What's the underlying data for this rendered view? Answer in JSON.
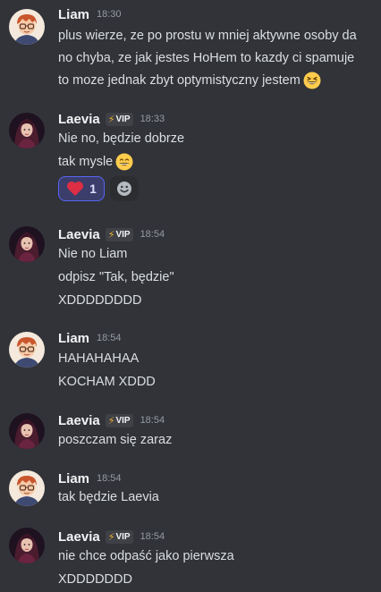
{
  "messages": [
    {
      "author": "Liam",
      "time": "18:30",
      "lines": [
        "plus wierze, ze po prostu w mniej aktywne osoby da",
        "no chyba, ze jak jestes HoHem to kazdy ci spamuje",
        "to moze jednak zbyt optymistyczny jestem"
      ]
    },
    {
      "author": "Laevia",
      "badge": "VIP",
      "time": "18:33",
      "lines": [
        "Nie no, będzie dobrze",
        "tak mysle"
      ],
      "reaction": {
        "emoji": "heart",
        "count": "1"
      }
    },
    {
      "author": "Laevia",
      "badge": "VIP",
      "time": "18:54",
      "lines": [
        "Nie no Liam",
        "odpisz \"Tak, będzie\"",
        "XDDDDDDDD"
      ]
    },
    {
      "author": "Liam",
      "time": "18:54",
      "lines": [
        "HAHAHAHAA",
        "KOCHAM XDDD"
      ]
    },
    {
      "author": "Laevia",
      "badge": "VIP",
      "time": "18:54",
      "lines": [
        "poszczam się zaraz"
      ]
    },
    {
      "author": "Liam",
      "time": "18:54",
      "lines": [
        "tak będzie Laevia"
      ]
    },
    {
      "author": "Laevia",
      "badge": "VIP",
      "time": "18:54",
      "lines": [
        "nie chce odpaść jako pierwsza",
        "XDDDDDDD"
      ]
    }
  ],
  "colors": {
    "background": "#313338",
    "reaction_border": "#5865f2",
    "vip_bolt": "#f0b232"
  }
}
